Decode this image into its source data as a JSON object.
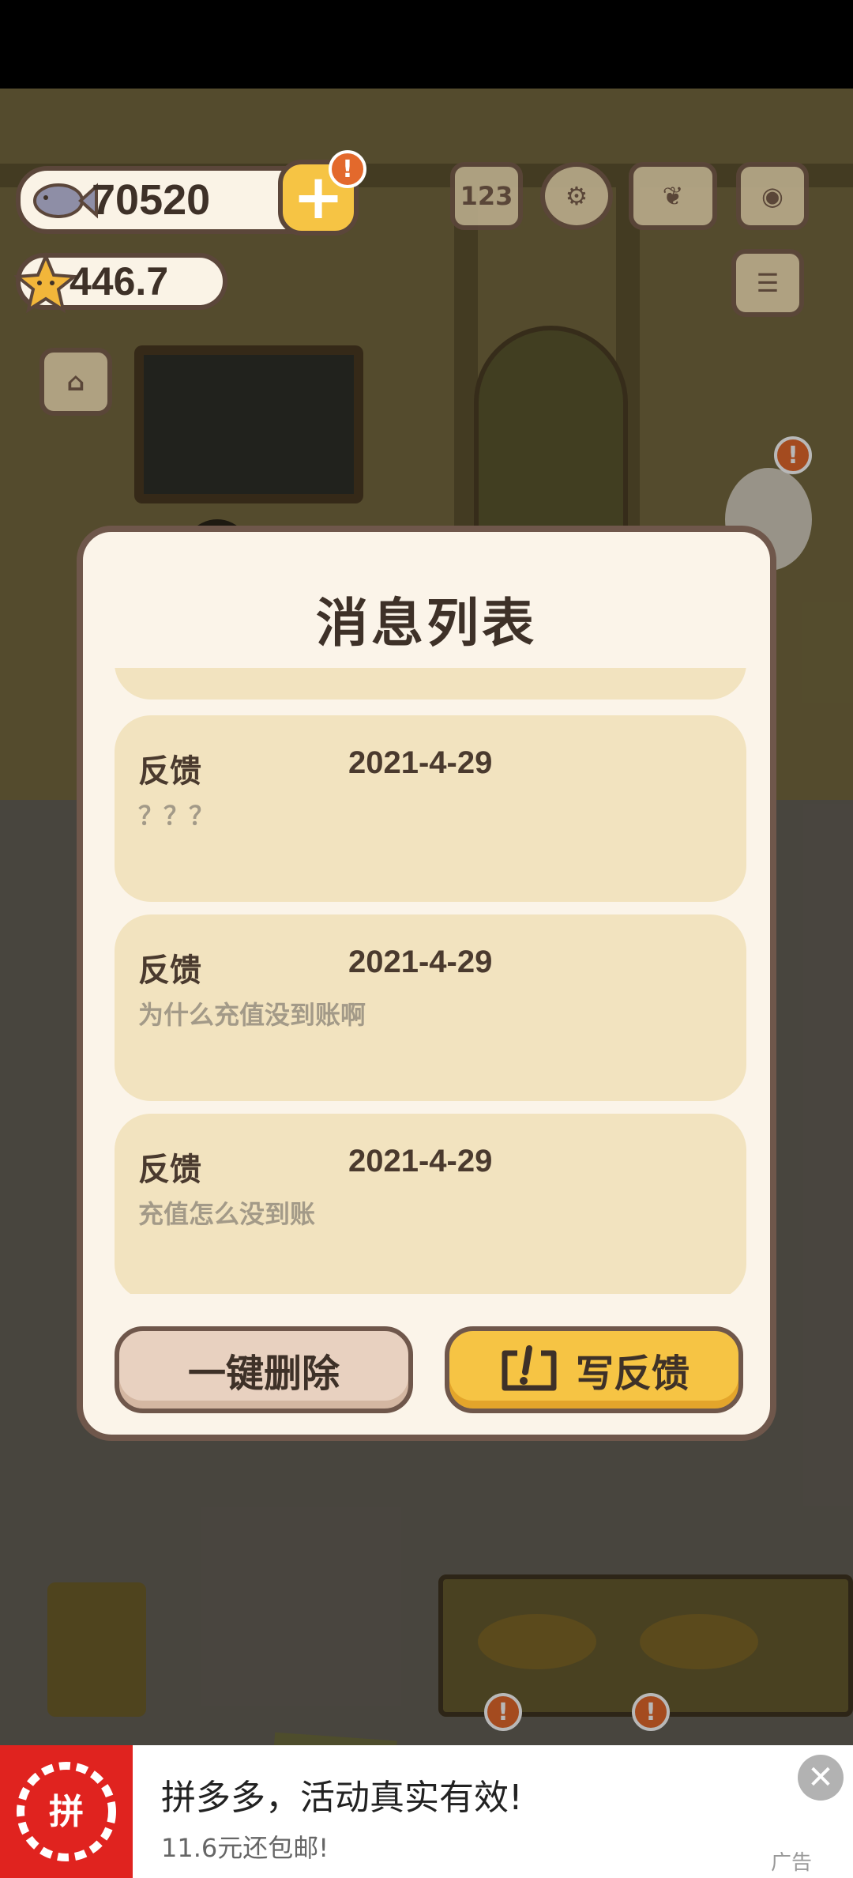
{
  "hud": {
    "fish_count": "70520",
    "star_count": "446.7",
    "plus_badge": "!",
    "icons": [
      "ranking-icon",
      "settings-gear-icon",
      "paw-book-icon",
      "camera-icon",
      "news-icon",
      "shop-icon"
    ]
  },
  "dialog": {
    "title": "消息列表",
    "messages": [
      {
        "type": "反馈",
        "date": "2021-4-29",
        "body": "？？？"
      },
      {
        "type": "反馈",
        "date": "2021-4-29",
        "body": "为什么充值没到账啊"
      },
      {
        "type": "反馈",
        "date": "2021-4-29",
        "body": "充值怎么没到账"
      }
    ],
    "delete_all_label": "一键删除",
    "write_feedback_label": "写反馈"
  },
  "scene": {
    "alert_badge": "!"
  },
  "ad": {
    "title": "拼多多，活动真实有效!",
    "subtitle": "11.6元还包邮!",
    "tag": "广告",
    "logo_text": "拼",
    "close_label": "✕"
  },
  "colors": {
    "accent_yellow": "#f6c444",
    "dialog_bg": "#fbf4e9",
    "card_bg": "#f2e3bf",
    "border_brown": "#6f574b",
    "ad_red": "#e0231f",
    "alert_orange": "#e3692c"
  }
}
